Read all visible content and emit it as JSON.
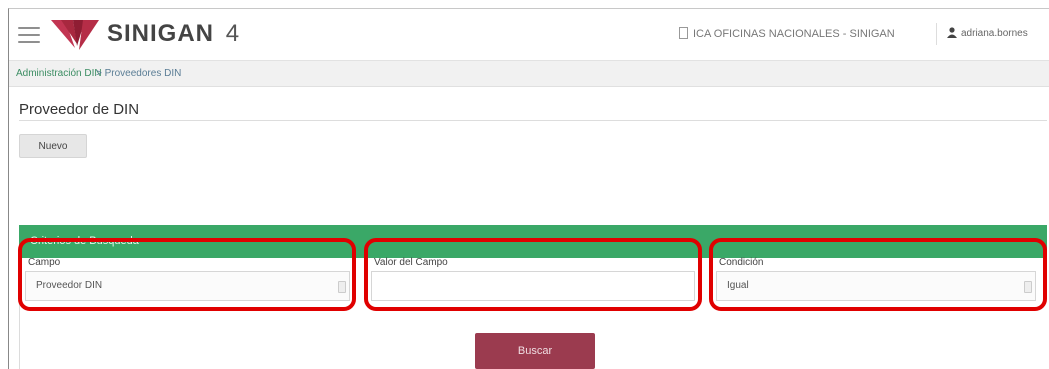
{
  "header": {
    "brand": "SINIGAN",
    "version": "4",
    "office": "ICA OFICINAS NACIONALES - SINIGAN",
    "user": "adriana.bornes",
    "icons": [
      "menu-icon",
      "sinigan-logo",
      "building-icon",
      "user-icon"
    ]
  },
  "breadcrumb": {
    "parent": "Administración DIN",
    "separator": ">",
    "current": "Proveedores DIN"
  },
  "page": {
    "title": "Proveedor de DIN",
    "new_button": "Nuevo"
  },
  "search": {
    "header": "Criterios de Busqueda",
    "campo": {
      "label": "Campo",
      "value": "Proveedor DIN"
    },
    "valor": {
      "label": "Valor del Campo",
      "value": ""
    },
    "condicion": {
      "label": "Condición",
      "value": "Igual"
    },
    "submit": "Buscar"
  },
  "colors": {
    "panel_header": "#3aa867",
    "search_button": "#9b3b4f",
    "highlight": "#e00000",
    "logo": "#a8283f"
  }
}
